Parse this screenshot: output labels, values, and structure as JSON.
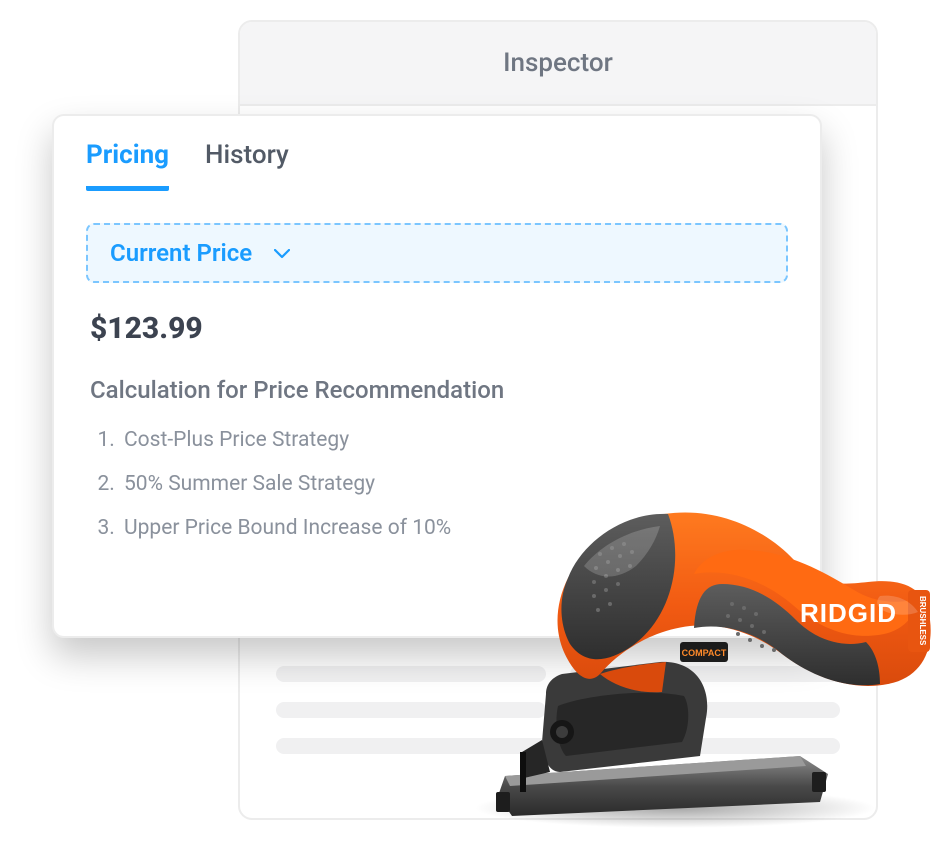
{
  "inspector": {
    "title": "Inspector"
  },
  "card": {
    "tabs": [
      {
        "label": "Pricing",
        "active": true
      },
      {
        "label": "History",
        "active": false
      }
    ],
    "dropdown": {
      "label": "Current Price"
    },
    "price": "$123.99",
    "calc_heading": "Calculation for Price Recommendation",
    "strategies": [
      "Cost-Plus Price Strategy",
      "50% Summer Sale Strategy",
      "Upper Price Bound Increase of 10%"
    ]
  },
  "product": {
    "brand": "RIDGID",
    "label": "BRUSHLESS",
    "badge": "COMPACT"
  }
}
